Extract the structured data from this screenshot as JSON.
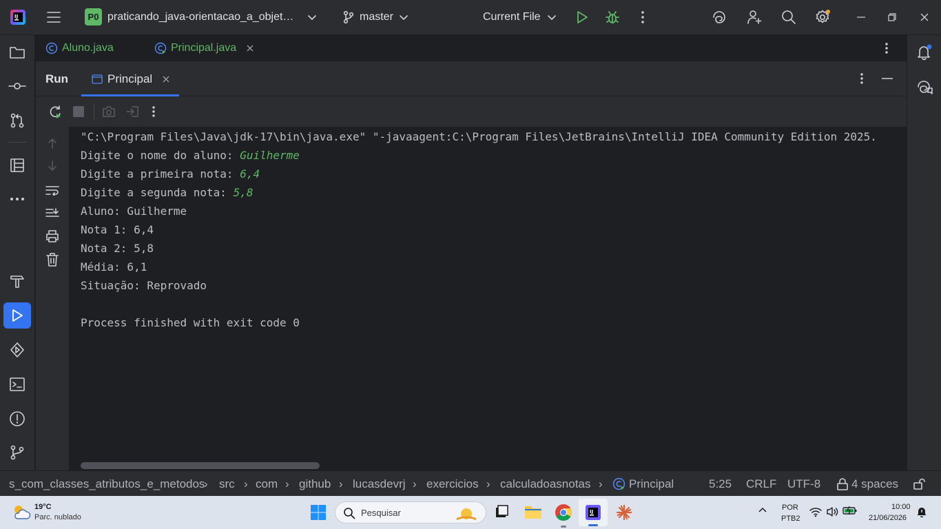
{
  "titlebar": {
    "project_badge": "P0",
    "project_name": "praticando_java-orientacao_a_objet…",
    "branch": "master",
    "run_config": "Current File"
  },
  "editor_tabs": [
    {
      "label": "Aluno.java"
    },
    {
      "label": "Principal.java"
    }
  ],
  "run_panel": {
    "title": "Run",
    "tab_label": "Principal"
  },
  "console": {
    "lines": [
      {
        "text": "\"C:\\Program Files\\Java\\jdk-17\\bin\\java.exe\" \"-javaagent:C:\\Program Files\\JetBrains\\IntelliJ IDEA Community Edition 2025.",
        "input": ""
      },
      {
        "text": "Digite o nome do aluno: ",
        "input": "Guilherme"
      },
      {
        "text": "Digite a primeira nota: ",
        "input": "6,4"
      },
      {
        "text": "Digite a segunda nota: ",
        "input": "5,8"
      },
      {
        "text": "Aluno: Guilherme",
        "input": ""
      },
      {
        "text": "Nota 1: 6,4",
        "input": ""
      },
      {
        "text": "Nota 2: 5,8",
        "input": ""
      },
      {
        "text": "Média: 6,1",
        "input": ""
      },
      {
        "text": "Situação: Reprovado",
        "input": ""
      },
      {
        "text": "",
        "input": ""
      },
      {
        "text": "Process finished with exit code 0",
        "input": ""
      }
    ]
  },
  "breadcrumb": [
    "s_com_classes_atributos_e_metodos",
    "src",
    "com",
    "github",
    "lucasdevrj",
    "exercicios",
    "calculadoasnotas",
    "Principal"
  ],
  "status": {
    "position": "5:25",
    "line_sep": "CRLF",
    "encoding": "UTF-8",
    "indent": "4 spaces"
  },
  "taskbar": {
    "weather_temp": "19°C",
    "weather_desc": "Parc. nublado",
    "search_placeholder": "Pesquisar",
    "lang_1": "POR",
    "lang_2": "PTB2",
    "time": "10:00",
    "date": "21/06/2026"
  },
  "colors": {
    "accent": "#3574f0",
    "green": "#5fb865",
    "bg": "#1e1f22",
    "panel": "#2b2d30"
  }
}
